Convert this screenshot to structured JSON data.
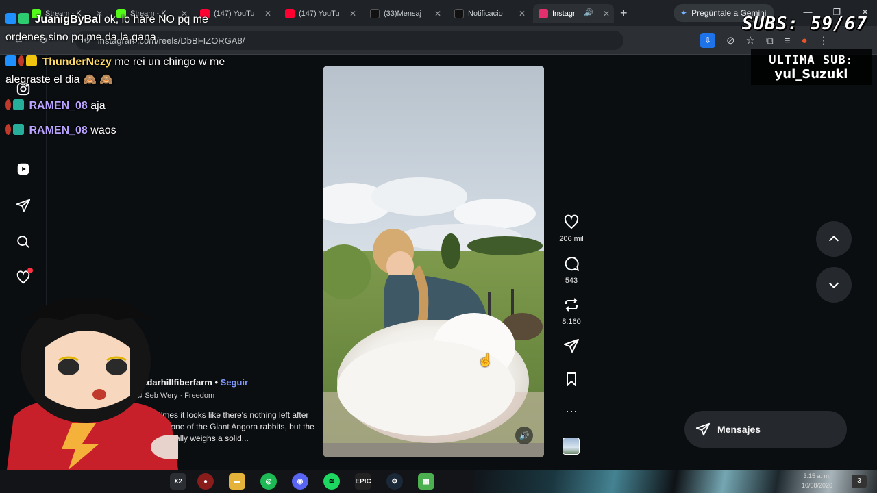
{
  "browser": {
    "tabs": [
      {
        "label": "Stream - K",
        "color": "#53fc18",
        "active": false
      },
      {
        "label": "Stream - K",
        "color": "#53fc18",
        "active": false
      },
      {
        "label": "(147) YouTu",
        "color": "#ff0033",
        "active": false
      },
      {
        "label": "(147) YouTu",
        "color": "#ff0033",
        "active": false
      },
      {
        "label": "(33)Mensaj",
        "color": "#111111",
        "active": false
      },
      {
        "label": "Notificacio",
        "color": "#111111",
        "active": false
      },
      {
        "label": "Instagr",
        "color": "#e1306c",
        "active": true
      }
    ],
    "new_tab": "+",
    "gemini_label": "Pregúntale a Gemini",
    "url": "instagram.com/reels/DbBFIZORGA8/"
  },
  "chat": [
    {
      "name": "JuanigByBal",
      "name_color": "#ffffff",
      "message": "ok, lo hare NO pq me",
      "badges": [
        "#1e90ff",
        "#2ecc71"
      ]
    },
    {
      "name": "",
      "name_color": "#ffffff",
      "message": "ordenes sino pq me da la gana",
      "badges": []
    },
    {
      "name": "ThunderNezy",
      "name_color": "#ffd966",
      "message": "me rei un chingo w me",
      "badges": [
        "#1e90ff",
        "#c0392b",
        "#f1c40f"
      ]
    },
    {
      "name": "",
      "name_color": "#ffffff",
      "message": "alegraste el dia",
      "badges": []
    },
    {
      "name": "RAMEN_08",
      "name_color": "#b9a3ff",
      "message": "aja",
      "badges": [
        "#c0392b",
        "#27ae9a"
      ]
    },
    {
      "name": "RAMEN_08",
      "name_color": "#b9a3ff",
      "message": "waos",
      "badges": [
        "#c0392b",
        "#27ae9a"
      ]
    }
  ],
  "overlay": {
    "subs": "SUBS: 59/67",
    "last_sub_title": "ULTIMA SUB:",
    "last_sub_name": "yul_Suzuki"
  },
  "reel": {
    "likes": "206 mil",
    "comments": "543",
    "reposts": "8.160",
    "username": "cedarhillfiberfarm",
    "follow": "Seguir",
    "audio": "Seb Wery · Freedom",
    "caption": "Sometimes it looks like there's nothing left after shearing one of the Giant Angora rabbits, but the rabbit actually weighs a solid..."
  },
  "messages_label": "Mensajes",
  "taskbar": {
    "time": "3:15 a. m.",
    "date": "10/08/2026",
    "notifications": "3"
  }
}
